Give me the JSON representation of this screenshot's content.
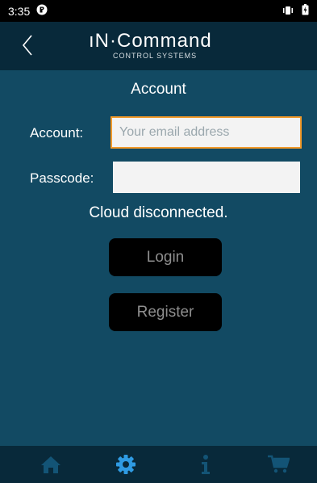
{
  "status_bar": {
    "time": "3:35"
  },
  "header": {
    "logo_main": "ıN·Command",
    "logo_sub": "CONTROL SYSTEMS"
  },
  "page": {
    "title": "Account"
  },
  "form": {
    "account_label": "Account:",
    "account_placeholder": "Your email address",
    "account_value": "",
    "passcode_label": "Passcode:",
    "passcode_value": ""
  },
  "status": {
    "cloud": "Cloud disconnected."
  },
  "buttons": {
    "login": "Login",
    "register": "Register"
  },
  "tabs": [
    {
      "icon": "home-icon",
      "active": false
    },
    {
      "icon": "gear-icon",
      "active": true
    },
    {
      "icon": "info-icon",
      "active": false
    },
    {
      "icon": "cart-icon",
      "active": false
    }
  ],
  "colors": {
    "background": "#124a63",
    "header": "#08293a",
    "focus_border": "#f39a2a",
    "active_tab": "#2f9be3",
    "inactive_tab": "#135476"
  }
}
